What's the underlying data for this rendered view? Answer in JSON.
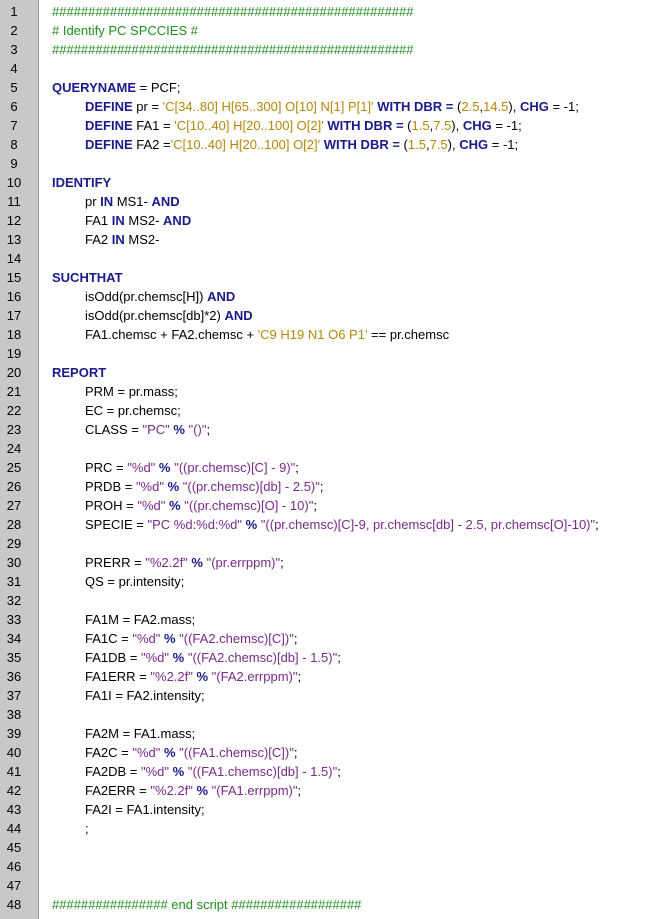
{
  "editor": {
    "colors": {
      "gutter": "#c8c8c8",
      "keyword": "#1a1a8c",
      "comment": "#1f8f1f",
      "string": "#b8860b",
      "format_string": "#7a2a8a"
    },
    "lines": [
      {
        "n": "1",
        "tokens": [
          {
            "t": "##################################################",
            "c": "cm"
          }
        ]
      },
      {
        "n": "2",
        "tokens": [
          {
            "t": "# Identify PC SPCCIES #",
            "c": "cm"
          }
        ]
      },
      {
        "n": "3",
        "tokens": [
          {
            "t": "##################################################",
            "c": "cm"
          }
        ]
      },
      {
        "n": "4",
        "tokens": []
      },
      {
        "n": "5",
        "tokens": [
          {
            "t": "QUERYNAME",
            "c": "kw"
          },
          {
            "t": " = PCF;",
            "c": "pl"
          }
        ]
      },
      {
        "n": "6",
        "indent": true,
        "tokens": [
          {
            "t": "DEFINE",
            "c": "kw"
          },
          {
            "t": " pr = ",
            "c": "pl"
          },
          {
            "t": "'C[34..80] H[65..300] O[10] N[1] P[1]'",
            "c": "st"
          },
          {
            "t": " WITH DBR = ",
            "c": "kw"
          },
          {
            "t": "(",
            "c": "pl"
          },
          {
            "t": "2.5",
            "c": "nm"
          },
          {
            "t": ",",
            "c": "pl"
          },
          {
            "t": "14.5",
            "c": "nm"
          },
          {
            "t": "), ",
            "c": "pl"
          },
          {
            "t": "CHG",
            "c": "kw"
          },
          {
            "t": " = -1;",
            "c": "pl"
          }
        ]
      },
      {
        "n": "7",
        "indent": true,
        "tokens": [
          {
            "t": "DEFINE",
            "c": "kw"
          },
          {
            "t": " FA1 = ",
            "c": "pl"
          },
          {
            "t": "'C[10..40] H[20..100] O[2]'",
            "c": "st"
          },
          {
            "t": " WITH DBR = ",
            "c": "kw"
          },
          {
            "t": "(",
            "c": "pl"
          },
          {
            "t": "1.5",
            "c": "nm"
          },
          {
            "t": ",",
            "c": "pl"
          },
          {
            "t": "7.5",
            "c": "nm"
          },
          {
            "t": "), ",
            "c": "pl"
          },
          {
            "t": "CHG",
            "c": "kw"
          },
          {
            "t": " = -1;",
            "c": "pl"
          }
        ]
      },
      {
        "n": "8",
        "indent": true,
        "tokens": [
          {
            "t": "DEFINE",
            "c": "kw"
          },
          {
            "t": " FA2 =",
            "c": "pl"
          },
          {
            "t": "'C[10..40] H[20..100] O[2]'",
            "c": "st"
          },
          {
            "t": " WITH DBR = ",
            "c": "kw"
          },
          {
            "t": "(",
            "c": "pl"
          },
          {
            "t": "1.5",
            "c": "nm"
          },
          {
            "t": ",",
            "c": "pl"
          },
          {
            "t": "7.5",
            "c": "nm"
          },
          {
            "t": "), ",
            "c": "pl"
          },
          {
            "t": "CHG",
            "c": "kw"
          },
          {
            "t": " = -1;",
            "c": "pl"
          }
        ]
      },
      {
        "n": "9",
        "tokens": []
      },
      {
        "n": "10",
        "tokens": [
          {
            "t": "IDENTIFY",
            "c": "kw"
          }
        ]
      },
      {
        "n": "11",
        "indent": true,
        "tokens": [
          {
            "t": "pr ",
            "c": "pl"
          },
          {
            "t": "IN",
            "c": "kw"
          },
          {
            "t": " MS1- ",
            "c": "pl"
          },
          {
            "t": "AND",
            "c": "kw"
          }
        ]
      },
      {
        "n": "12",
        "indent": true,
        "tokens": [
          {
            "t": "FA1 ",
            "c": "pl"
          },
          {
            "t": "IN",
            "c": "kw"
          },
          {
            "t": " MS2- ",
            "c": "pl"
          },
          {
            "t": "AND",
            "c": "kw"
          }
        ]
      },
      {
        "n": "13",
        "indent": true,
        "tokens": [
          {
            "t": "FA2 ",
            "c": "pl"
          },
          {
            "t": "IN",
            "c": "kw"
          },
          {
            "t": " MS2-",
            "c": "pl"
          }
        ]
      },
      {
        "n": "14",
        "tokens": []
      },
      {
        "n": "15",
        "tokens": [
          {
            "t": "SUCHTHAT",
            "c": "kw"
          }
        ]
      },
      {
        "n": "16",
        "indent": true,
        "tokens": [
          {
            "t": "isOdd(pr.chemsc[H]) ",
            "c": "pl"
          },
          {
            "t": "AND",
            "c": "kw"
          }
        ]
      },
      {
        "n": "17",
        "indent": true,
        "tokens": [
          {
            "t": "isOdd(pr.chemsc[db]*2) ",
            "c": "pl"
          },
          {
            "t": "AND",
            "c": "kw"
          }
        ]
      },
      {
        "n": "18",
        "indent": true,
        "tokens": [
          {
            "t": "FA1.chemsc + FA2.chemsc + ",
            "c": "pl"
          },
          {
            "t": "'C9 H19 N1 O6 P1'",
            "c": "st"
          },
          {
            "t": " == pr.chemsc",
            "c": "pl"
          }
        ]
      },
      {
        "n": "19",
        "tokens": []
      },
      {
        "n": "20",
        "tokens": [
          {
            "t": "REPORT",
            "c": "kw"
          }
        ]
      },
      {
        "n": "21",
        "indent": true,
        "tokens": [
          {
            "t": "PRM = pr.mass;",
            "c": "pl"
          }
        ]
      },
      {
        "n": "22",
        "indent": true,
        "tokens": [
          {
            "t": "EC = pr.chemsc;",
            "c": "pl"
          }
        ]
      },
      {
        "n": "23",
        "indent": true,
        "tokens": [
          {
            "t": "CLASS = ",
            "c": "pl"
          },
          {
            "t": "\"PC\"",
            "c": "sp"
          },
          {
            "t": " % ",
            "c": "kw"
          },
          {
            "t": "\"()\"",
            "c": "sp"
          },
          {
            "t": ";",
            "c": "pl"
          }
        ]
      },
      {
        "n": "24",
        "tokens": []
      },
      {
        "n": "25",
        "indent": true,
        "tokens": [
          {
            "t": "PRC = ",
            "c": "pl"
          },
          {
            "t": "\"%d\"",
            "c": "sp"
          },
          {
            "t": " % ",
            "c": "kw"
          },
          {
            "t": "\"((pr.chemsc)[C] - 9)\"",
            "c": "sp"
          },
          {
            "t": ";",
            "c": "pl"
          }
        ]
      },
      {
        "n": "26",
        "indent": true,
        "tokens": [
          {
            "t": "PRDB = ",
            "c": "pl"
          },
          {
            "t": "\"%d\"",
            "c": "sp"
          },
          {
            "t": " % ",
            "c": "kw"
          },
          {
            "t": "\"((pr.chemsc)[db] - 2.5)\"",
            "c": "sp"
          },
          {
            "t": ";",
            "c": "pl"
          }
        ]
      },
      {
        "n": "27",
        "indent": true,
        "tokens": [
          {
            "t": "PROH = ",
            "c": "pl"
          },
          {
            "t": "\"%d\"",
            "c": "sp"
          },
          {
            "t": " % ",
            "c": "kw"
          },
          {
            "t": "\"((pr.chemsc)[O] - 10)\"",
            "c": "sp"
          },
          {
            "t": ";",
            "c": "pl"
          }
        ]
      },
      {
        "n": "28",
        "indent": true,
        "tokens": [
          {
            "t": "SPECIE = ",
            "c": "pl"
          },
          {
            "t": "\"PC %d:%d:%d\"",
            "c": "sp"
          },
          {
            "t": " % ",
            "c": "kw"
          },
          {
            "t": "\"((pr.chemsc)[C]-9, pr.chemsc[db] - 2.5, pr.chemsc[O]-10)\"",
            "c": "sp"
          },
          {
            "t": ";",
            "c": "pl"
          }
        ]
      },
      {
        "n": "29",
        "tokens": []
      },
      {
        "n": "30",
        "indent": true,
        "tokens": [
          {
            "t": "PRERR = ",
            "c": "pl"
          },
          {
            "t": "\"%2.2f\"",
            "c": "sp"
          },
          {
            "t": " % ",
            "c": "kw"
          },
          {
            "t": "\"(pr.errppm)\"",
            "c": "sp"
          },
          {
            "t": ";",
            "c": "pl"
          }
        ]
      },
      {
        "n": "31",
        "indent": true,
        "tokens": [
          {
            "t": "QS = pr.intensity;",
            "c": "pl"
          }
        ]
      },
      {
        "n": "32",
        "tokens": []
      },
      {
        "n": "33",
        "indent": true,
        "tokens": [
          {
            "t": "FA1M = FA2.mass;",
            "c": "pl"
          }
        ]
      },
      {
        "n": "34",
        "indent": true,
        "tokens": [
          {
            "t": "FA1C = ",
            "c": "pl"
          },
          {
            "t": "\"%d\"",
            "c": "sp"
          },
          {
            "t": " % ",
            "c": "kw"
          },
          {
            "t": "\"((FA2.chemsc)[C])\"",
            "c": "sp"
          },
          {
            "t": ";",
            "c": "pl"
          }
        ]
      },
      {
        "n": "35",
        "indent": true,
        "tokens": [
          {
            "t": "FA1DB = ",
            "c": "pl"
          },
          {
            "t": "\"%d\"",
            "c": "sp"
          },
          {
            "t": " % ",
            "c": "kw"
          },
          {
            "t": "\"((FA2.chemsc)[db] - 1.5)\"",
            "c": "sp"
          },
          {
            "t": ";",
            "c": "pl"
          }
        ]
      },
      {
        "n": "36",
        "indent": true,
        "tokens": [
          {
            "t": "FA1ERR = ",
            "c": "pl"
          },
          {
            "t": "\"%2.2f\"",
            "c": "sp"
          },
          {
            "t": " % ",
            "c": "kw"
          },
          {
            "t": "\"(FA2.errppm)\"",
            "c": "sp"
          },
          {
            "t": ";",
            "c": "pl"
          }
        ]
      },
      {
        "n": "37",
        "indent": true,
        "tokens": [
          {
            "t": "FA1I = FA2.intensity;",
            "c": "pl"
          }
        ]
      },
      {
        "n": "38",
        "tokens": []
      },
      {
        "n": "39",
        "indent": true,
        "tokens": [
          {
            "t": "FA2M = FA1.mass;",
            "c": "pl"
          }
        ]
      },
      {
        "n": "40",
        "indent": true,
        "tokens": [
          {
            "t": "FA2C = ",
            "c": "pl"
          },
          {
            "t": "\"%d\"",
            "c": "sp"
          },
          {
            "t": " % ",
            "c": "kw"
          },
          {
            "t": "\"((FA1.chemsc)[C])\"",
            "c": "sp"
          },
          {
            "t": ";",
            "c": "pl"
          }
        ]
      },
      {
        "n": "41",
        "indent": true,
        "tokens": [
          {
            "t": "FA2DB = ",
            "c": "pl"
          },
          {
            "t": "\"%d\"",
            "c": "sp"
          },
          {
            "t": " % ",
            "c": "kw"
          },
          {
            "t": "\"((FA1.chemsc)[db] - 1.5)\"",
            "c": "sp"
          },
          {
            "t": ";",
            "c": "pl"
          }
        ]
      },
      {
        "n": "42",
        "indent": true,
        "tokens": [
          {
            "t": "FA2ERR = ",
            "c": "pl"
          },
          {
            "t": "\"%2.2f\"",
            "c": "sp"
          },
          {
            "t": " % ",
            "c": "kw"
          },
          {
            "t": "\"(FA1.errppm)\"",
            "c": "sp"
          },
          {
            "t": ";",
            "c": "pl"
          }
        ]
      },
      {
        "n": "43",
        "indent": true,
        "tokens": [
          {
            "t": "FA2I = FA1.intensity;",
            "c": "pl"
          }
        ]
      },
      {
        "n": "44",
        "indent": true,
        "tokens": [
          {
            "t": ";",
            "c": "pl"
          }
        ]
      },
      {
        "n": "45",
        "tokens": []
      },
      {
        "n": "46",
        "tokens": []
      },
      {
        "n": "47",
        "tokens": []
      },
      {
        "n": "48",
        "tokens": [
          {
            "t": "################ end script ##################",
            "c": "cm"
          }
        ]
      }
    ]
  }
}
